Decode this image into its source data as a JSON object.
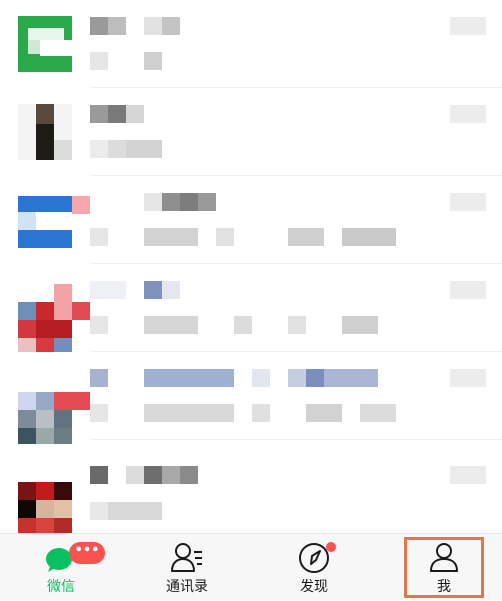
{
  "tabs": [
    {
      "label": "微信",
      "icon": "chat-icon",
      "badge": "•••",
      "active": true
    },
    {
      "label": "通讯录",
      "icon": "contacts-icon",
      "active": false
    },
    {
      "label": "发现",
      "icon": "compass-icon",
      "dot": true,
      "active": false
    },
    {
      "label": "我",
      "icon": "person-icon",
      "active": false
    }
  ],
  "colors": {
    "accent": "#07c160",
    "badge": "#fa5151",
    "highlight": "#e0784f"
  }
}
